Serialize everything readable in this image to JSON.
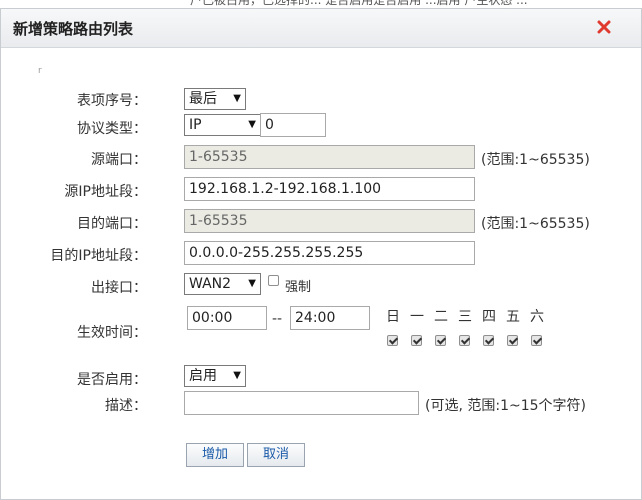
{
  "top_strip_text": "户已被占用，已选择的... 是否启用是否启用 ...启用 户主状态 ...",
  "dialog": {
    "title": "新增策略路由列表",
    "close_icon": "close-icon",
    "close_color": "#e03a2f"
  },
  "form": {
    "index": {
      "label": "表项序号：",
      "value": "最后"
    },
    "protocol": {
      "label": "协议类型：",
      "value": "IP",
      "number": "0"
    },
    "src_port": {
      "label": "源端口：",
      "value": "1-65535",
      "hint": "(范围:1~65535)"
    },
    "src_ip": {
      "label": "源IP地址段：",
      "value": "192.168.1.2-192.168.1.100"
    },
    "dst_port": {
      "label": "目的端口：",
      "value": "1-65535",
      "hint": "(范围:1~65535)"
    },
    "dst_ip": {
      "label": "目的IP地址段：",
      "value": "0.0.0.0-255.255.255.255"
    },
    "out_if": {
      "label": "出接口：",
      "value": "WAN2",
      "force_label": "强制",
      "force_checked": false
    },
    "time": {
      "label": "生效时间：",
      "start": "00:00",
      "sep": "--",
      "end": "24:00",
      "days": [
        {
          "name": "日",
          "checked": true
        },
        {
          "name": "一",
          "checked": true
        },
        {
          "name": "二",
          "checked": true
        },
        {
          "name": "三",
          "checked": true
        },
        {
          "name": "四",
          "checked": true
        },
        {
          "name": "五",
          "checked": true
        },
        {
          "name": "六",
          "checked": true
        }
      ]
    },
    "enabled": {
      "label": "是否启用：",
      "value": "启用"
    },
    "desc": {
      "label": "描述：",
      "value": "",
      "hint": "(可选, 范围:1~15个字符)"
    }
  },
  "buttons": {
    "add": "增加",
    "cancel": "取消"
  },
  "marker": "r"
}
